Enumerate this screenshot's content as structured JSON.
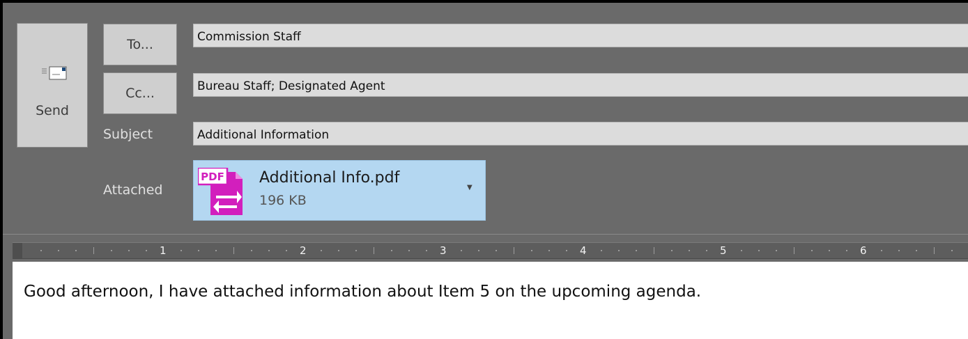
{
  "send": {
    "label": "Send"
  },
  "header": {
    "to_button": "To...",
    "cc_button": "Cc...",
    "to_value": "Commission Staff",
    "cc_value": "Bureau Staff; Designated Agent",
    "subject_label": "Subject",
    "subject_value": "Additional Information",
    "attached_label": "Attached"
  },
  "attachment": {
    "file_name": "Additional Info.pdf",
    "file_size": "196 KB",
    "icon": "pdf-file-icon",
    "badge": "PDF"
  },
  "ruler": {
    "numbers": [
      "1",
      "2",
      "3",
      "4",
      "5",
      "6"
    ]
  },
  "body": {
    "text": "Good afternoon, I have attached information about Item 5 on the upcoming agenda."
  },
  "colors": {
    "attachment_bg": "#b4d7f1",
    "pdf_magenta": "#d21fbd",
    "panel_bg": "#6a6a6a"
  }
}
